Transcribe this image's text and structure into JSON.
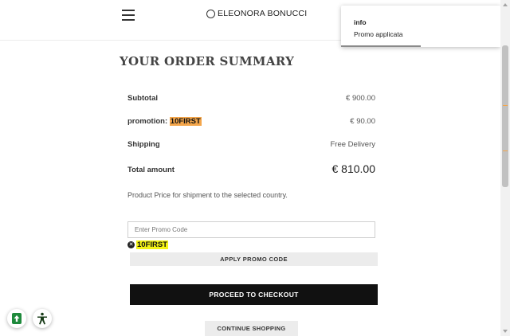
{
  "header": {
    "brand": "ELEONORA BONUCCI",
    "menu_icon": "hamburger-menu-icon",
    "brand_icon": "circle-logo-icon"
  },
  "summary": {
    "title": "YOUR ORDER SUMMARY",
    "subtotal_label": "Subtotal",
    "subtotal_value": "€ 900.00",
    "promotion_label": "promotion:",
    "promotion_code": "10FIRST",
    "promotion_value": "€ 90.00",
    "shipping_label": "Shipping",
    "shipping_value": "Free Delivery",
    "total_label": "Total amount",
    "total_value": "€ 810.00",
    "note": "Product Price for shipment to the selected country."
  },
  "promo": {
    "placeholder": "Enter Promo Code",
    "value": "",
    "applied_code": "10FIRST",
    "apply_label": "APPLY PROMO CODE"
  },
  "actions": {
    "checkout_label": "PROCEED TO CHECKOUT",
    "continue_label": "CONTINUE SHOPPING"
  },
  "toast": {
    "title": "info",
    "message": "Promo applicata",
    "progress": 0.5
  },
  "colors": {
    "promo_highlight": "#f4a64b",
    "code_highlight": "#f4f415",
    "checkout_bg": "#111111",
    "accessibility_green": "#1f8a3c",
    "accessibility_dark": "#1a3d1a"
  },
  "floating": {
    "scroll_top_icon": "arrow-up-icon",
    "accessibility_icon": "accessibility-person-icon"
  }
}
